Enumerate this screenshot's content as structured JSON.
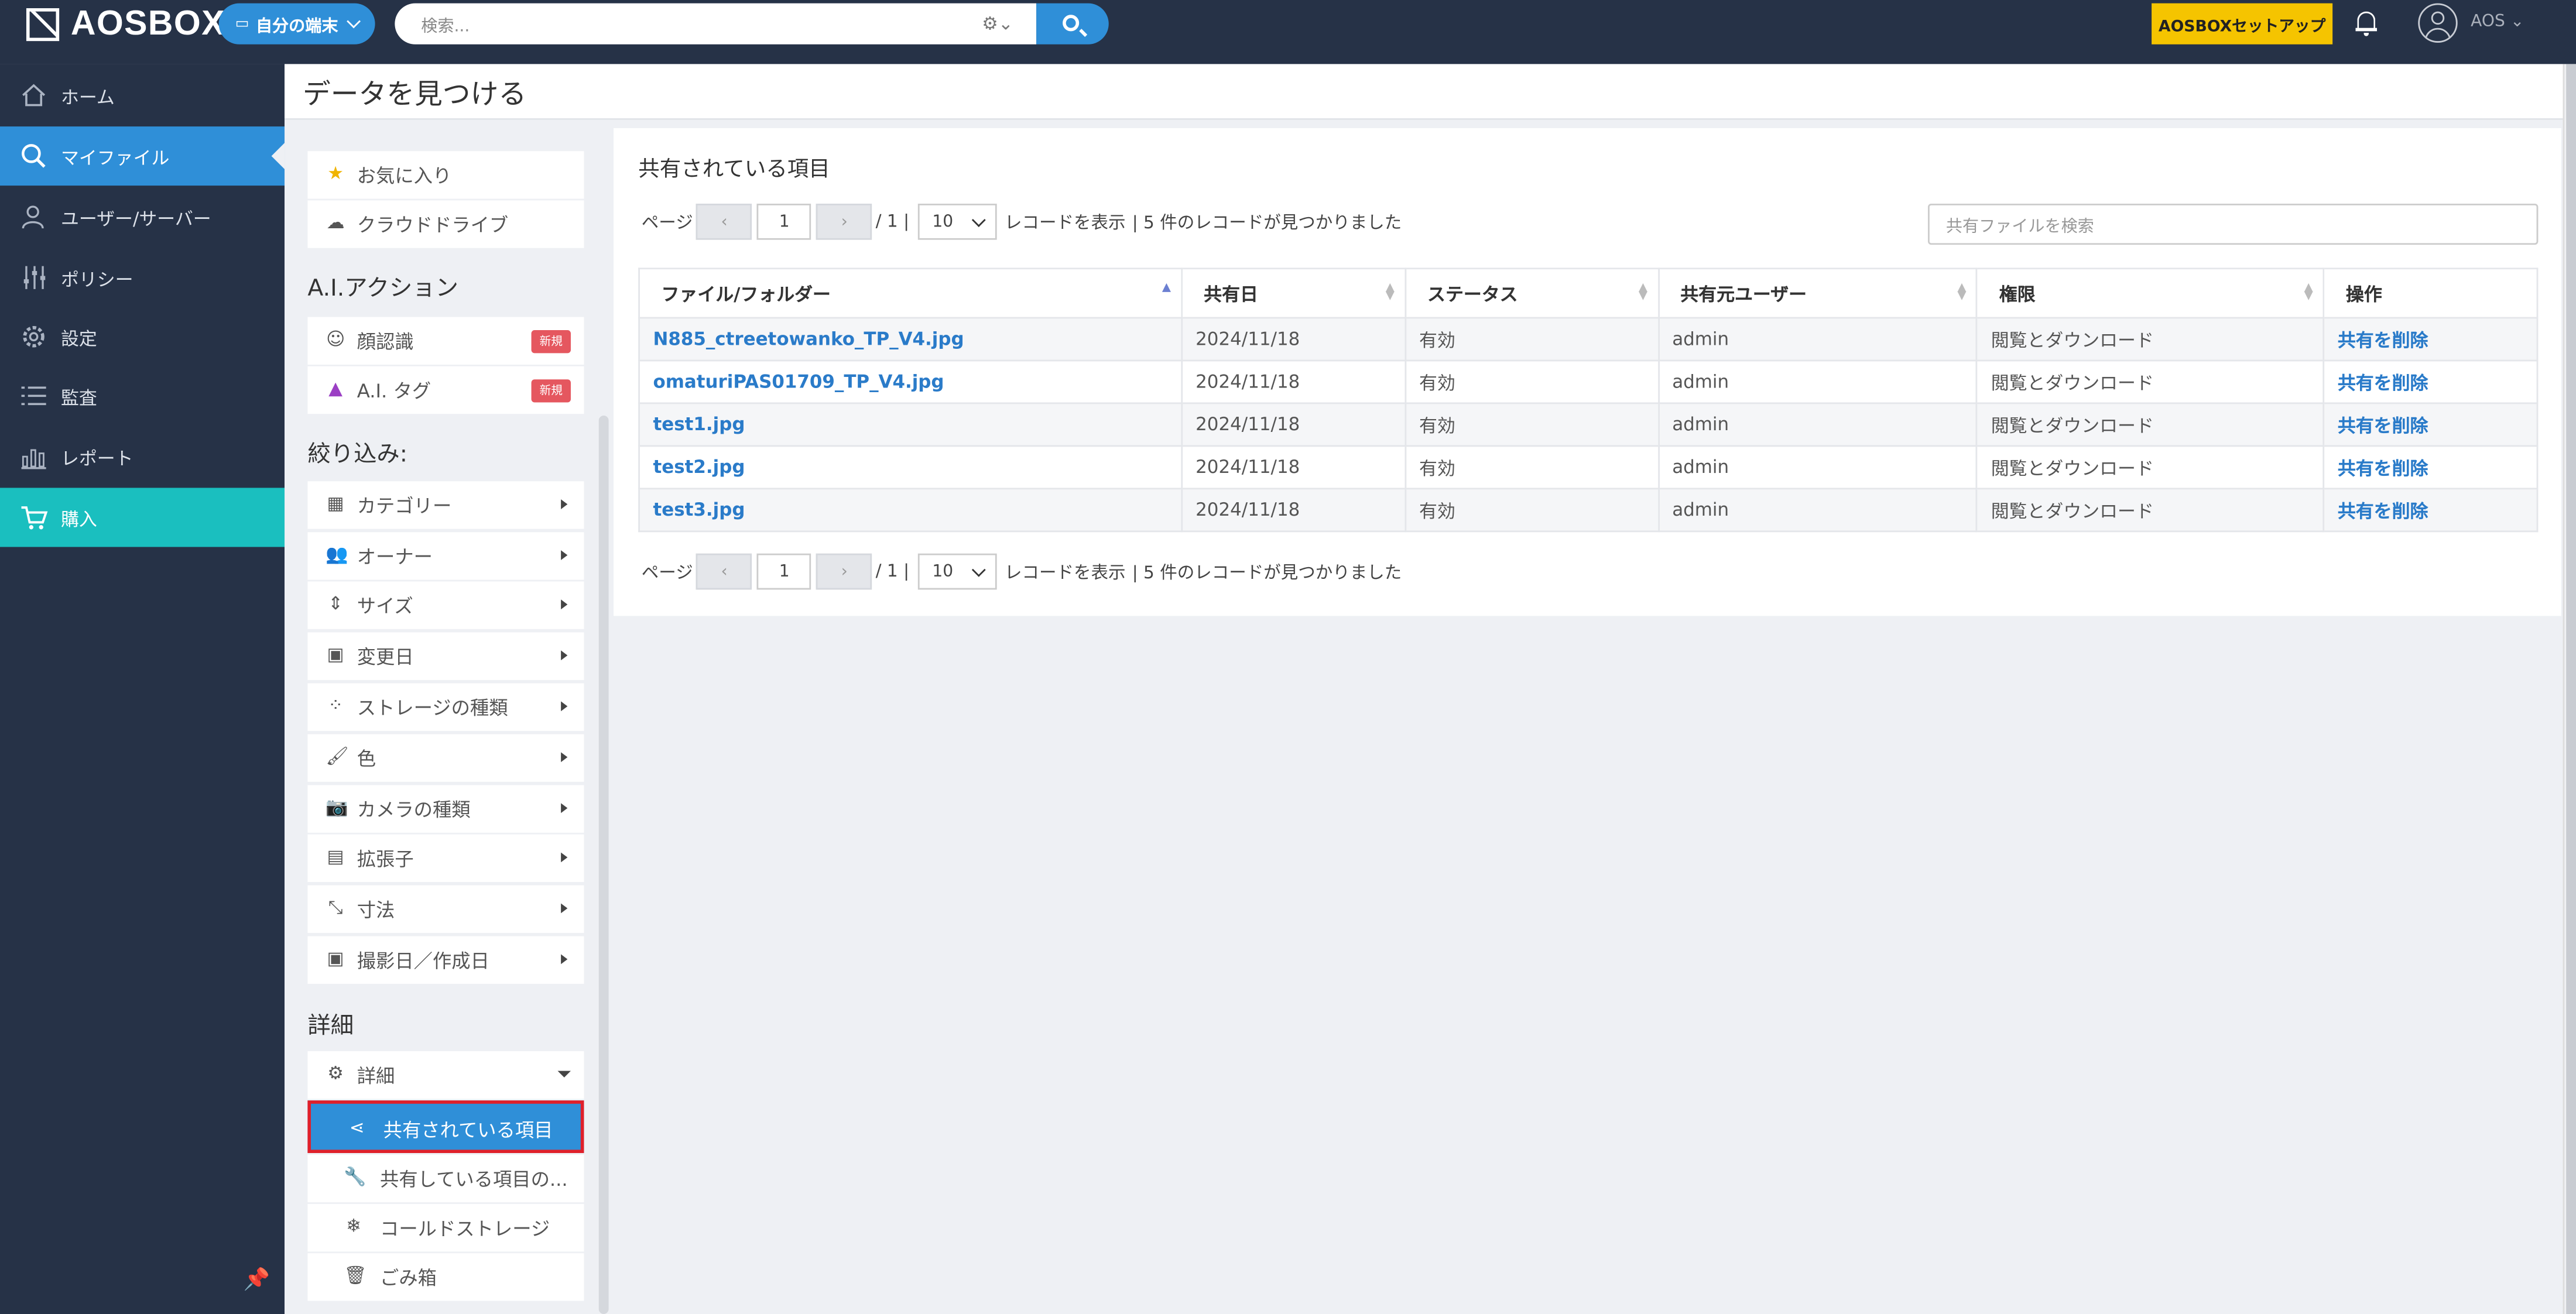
{
  "app": {
    "logo_text": "AOSBOX",
    "device_button": "自分の端末",
    "search_placeholder": "検索...",
    "setup_button": "AOSBOXセットアップ",
    "username": "AOS"
  },
  "sidebar": {
    "items": [
      {
        "label": "ホーム",
        "icon": "home-icon"
      },
      {
        "label": "マイファイル",
        "icon": "search-icon"
      },
      {
        "label": "ユーザー/サーバー",
        "icon": "users-icon"
      },
      {
        "label": "ポリシー",
        "icon": "sliders-icon"
      },
      {
        "label": "設定",
        "icon": "gear-icon"
      },
      {
        "label": "監査",
        "icon": "list-icon"
      },
      {
        "label": "レポート",
        "icon": "bar-chart-icon"
      },
      {
        "label": "購入",
        "icon": "cart-icon"
      }
    ]
  },
  "page": {
    "title": "データを見つける"
  },
  "left": {
    "favorites": "お気に入り",
    "cloud": "クラウドドライブ",
    "ai_section": "A.I.アクション",
    "face": "顔認識",
    "ai_tag": "A.I. タグ",
    "new_badge": "新規",
    "filter_section": "絞り込み:",
    "filters": [
      "カテゴリー",
      "オーナー",
      "サイズ",
      "変更日",
      "ストレージの種類",
      "色",
      "カメラの種類",
      "拡張子",
      "寸法",
      "撮影日／作成日"
    ],
    "detail_section": "詳細",
    "detail_toggle": "詳細",
    "shared_items": "共有されている項目",
    "sharing_items": "共有している項目の...",
    "cold_storage": "コールドストレージ",
    "trash": "ごみ箱"
  },
  "main": {
    "title": "共有されている項目",
    "page_label": "ページ",
    "prev": "‹",
    "next": "›",
    "page_value": "1",
    "page_total": "/ 1 |",
    "per_page": "10",
    "show_records": "レコードを表示",
    "found": "| 5 件のレコードが見つかりました",
    "search_placeholder": "共有ファイルを検索",
    "columns": [
      "ファイル/フォルダー",
      "共有日",
      "ステータス",
      "共有元ユーザー",
      "権限",
      "操作"
    ],
    "rows": [
      [
        "N885_ctreetowanko_TP_V4.jpg",
        "2024/11/18",
        "有効",
        "admin",
        "閲覧とダウンロード",
        "共有を削除"
      ],
      [
        "omaturiPAS01709_TP_V4.jpg",
        "2024/11/18",
        "有効",
        "admin",
        "閲覧とダウンロード",
        "共有を削除"
      ],
      [
        "test1.jpg",
        "2024/11/18",
        "有効",
        "admin",
        "閲覧とダウンロード",
        "共有を削除"
      ],
      [
        "test2.jpg",
        "2024/11/18",
        "有効",
        "admin",
        "閲覧とダウンロード",
        "共有を削除"
      ],
      [
        "test3.jpg",
        "2024/11/18",
        "有効",
        "admin",
        "閲覧とダウンロード",
        "共有を削除"
      ]
    ]
  },
  "colors": {
    "topbar": "#263247",
    "accent": "#2f8fd8",
    "buy": "#1abfbf",
    "setup": "#f5c400",
    "highlight": "#e0202a",
    "badge": "#e5575f"
  }
}
